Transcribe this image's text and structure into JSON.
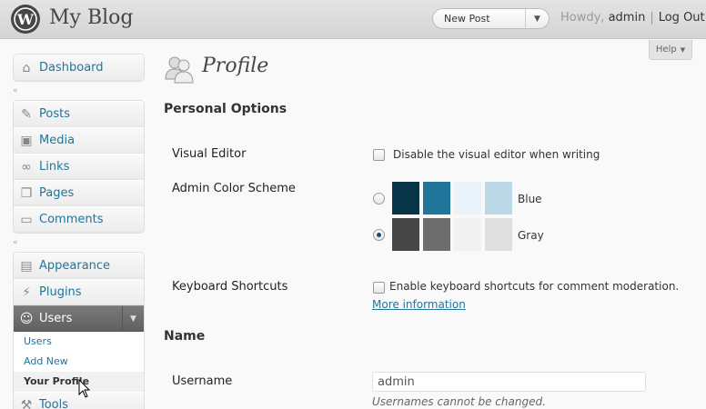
{
  "header": {
    "site_title": "My Blog",
    "favorite_action": "New Post",
    "greeting": "Howdy,",
    "user_name": "admin",
    "logout": "Log Out",
    "help": "Help"
  },
  "menu": {
    "dashboard": "Dashboard",
    "posts": "Posts",
    "media": "Media",
    "links": "Links",
    "pages": "Pages",
    "comments": "Comments",
    "appearance": "Appearance",
    "plugins": "Plugins",
    "users": "Users",
    "users_submenu": [
      "Users",
      "Add New",
      "Your Profile"
    ],
    "tools": "Tools"
  },
  "page": {
    "title": "Profile",
    "personal_options": "Personal Options",
    "visual_editor_label": "Visual Editor",
    "visual_editor_option": "Disable the visual editor when writing",
    "color_scheme_label": "Admin Color Scheme",
    "schemes": [
      {
        "name": "Blue",
        "selected": false,
        "colors": [
          "#073447",
          "#21759b",
          "#eaf3fa",
          "#bbd8e7"
        ]
      },
      {
        "name": "Gray",
        "selected": true,
        "colors": [
          "#464646",
          "#6d6d6d",
          "#f1f1f1",
          "#dfdfdf"
        ]
      }
    ],
    "keyboard_shortcuts_label": "Keyboard Shortcuts",
    "keyboard_shortcuts_option": "Enable keyboard shortcuts for comment moderation.",
    "more_information": "More information",
    "name_section": "Name",
    "username_label": "Username",
    "username_value": "admin",
    "username_note": "Usernames cannot be changed."
  },
  "colors": {
    "link": "#21759b",
    "menu_open": "#6d6d6d"
  }
}
